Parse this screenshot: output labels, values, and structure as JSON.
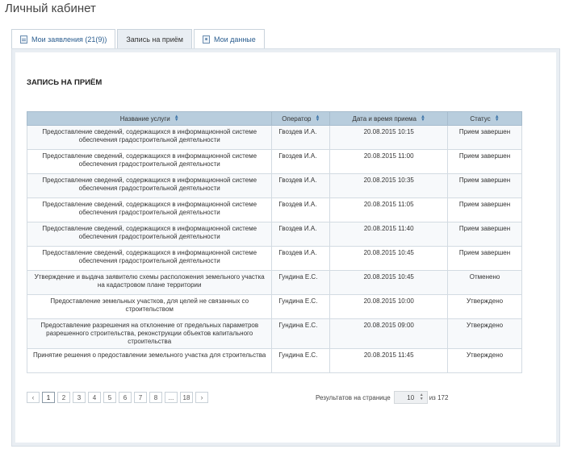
{
  "page_title": "Личный кабинет",
  "tabs": [
    {
      "label": "Мои заявления (21(9))",
      "icon": "document-icon",
      "active": false
    },
    {
      "label": "Запись на приём",
      "icon": "",
      "active": true
    },
    {
      "label": "Мои данные",
      "icon": "person-icon",
      "active": false
    }
  ],
  "section_title": "ЗАПИСЬ НА ПРИЁМ",
  "table": {
    "columns": [
      "Название услуги",
      "Оператор",
      "Дата и время приема",
      "Статус"
    ],
    "rows": [
      {
        "service": "Предоставление сведений, содержащихся в информационной системе обеспечения градостроительной деятельности",
        "operator": "Гвоздев И.А.",
        "datetime": "20.08.2015 10:15",
        "status": "Прием завершен"
      },
      {
        "service": "Предоставление сведений, содержащихся в информационной системе обеспечения градостроительной деятельности",
        "operator": "Гвоздев И.А.",
        "datetime": "20.08.2015 11:00",
        "status": "Прием завершен"
      },
      {
        "service": "Предоставление сведений, содержащихся в информационной системе обеспечения градостроительной деятельности",
        "operator": "Гвоздев И.А.",
        "datetime": "20.08.2015 10:35",
        "status": "Прием завершен"
      },
      {
        "service": "Предоставление сведений, содержащихся в информационной системе обеспечения градостроительной деятельности",
        "operator": "Гвоздев И.А.",
        "datetime": "20.08.2015 11:05",
        "status": "Прием завершен"
      },
      {
        "service": "Предоставление сведений, содержащихся в информационной системе обеспечения градостроительной деятельности",
        "operator": "Гвоздев И.А.",
        "datetime": "20.08.2015 11:40",
        "status": "Прием завершен"
      },
      {
        "service": "Предоставление сведений, содержащихся в информационной системе обеспечения градостроительной деятельности",
        "operator": "Гвоздев И.А.",
        "datetime": "20.08.2015 10:45",
        "status": "Прием завершен"
      },
      {
        "service": "Утверждение и выдача заявителю схемы расположения земельного участка на кадастровом плане территории",
        "operator": "Гундина Е.С.",
        "datetime": "20.08.2015 10:45",
        "status": "Отменено"
      },
      {
        "service": "Предоставление земельных участков, для целей не связанных со строительством",
        "operator": "Гундина Е.С.",
        "datetime": "20.08.2015 10:00",
        "status": "Утверждено"
      },
      {
        "service": "Предоставление разрешения на отклонение от предельных параметров разрешенного строительства, реконструкции объектов капитального строительства",
        "operator": "Гундина Е.С.",
        "datetime": "20.08.2015 09:00",
        "status": "Утверждено"
      },
      {
        "service": "Принятие решения о предоставлении земельного участка для строительства",
        "operator": "Гундина Е.С.",
        "datetime": "20.08.2015 11:45",
        "status": "Утверждено"
      }
    ]
  },
  "pagination": {
    "prev": "‹",
    "next": "›",
    "pages": [
      "1",
      "2",
      "3",
      "4",
      "5",
      "6",
      "7",
      "8",
      "...",
      "18"
    ],
    "current": "1",
    "per_page_label": "Результатов на странице",
    "per_page_value": "10",
    "total_label": "из 172"
  }
}
